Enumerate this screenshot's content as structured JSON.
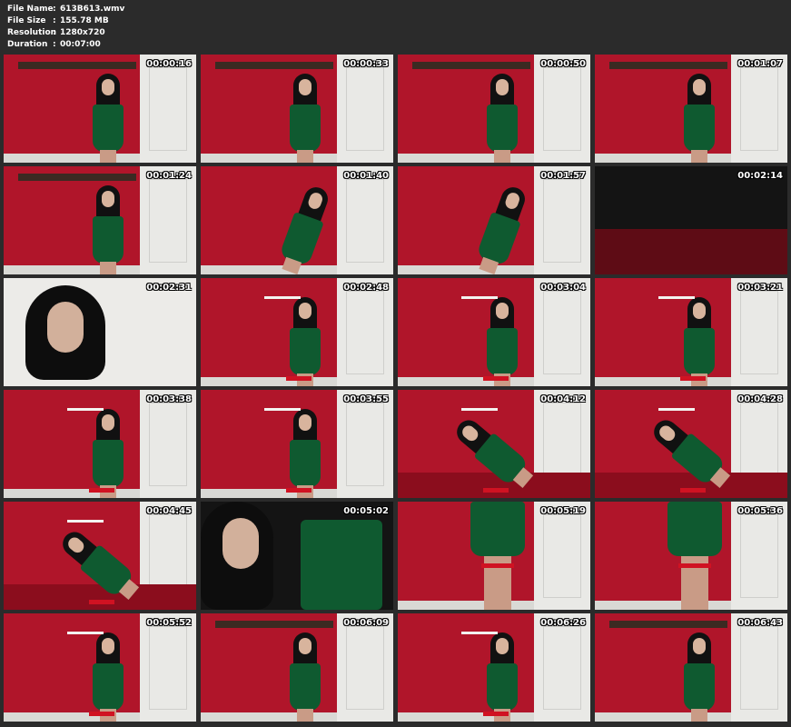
{
  "file_info": {
    "file_name_label": "File Name",
    "file_name_value": "613B613.wmv",
    "file_size_label": "File Size",
    "file_size_value": "155.78 MB",
    "resolution_label": "Resolution",
    "resolution_value": "1280x720",
    "duration_label": "Duration",
    "duration_value": "00:07:00"
  },
  "thumbnails": [
    {
      "timestamp": "00:00:16"
    },
    {
      "timestamp": "00:00:33"
    },
    {
      "timestamp": "00:00:50"
    },
    {
      "timestamp": "00:01:07"
    },
    {
      "timestamp": "00:01:24"
    },
    {
      "timestamp": "00:01:40"
    },
    {
      "timestamp": "00:01:57"
    },
    {
      "timestamp": "00:02:14"
    },
    {
      "timestamp": "00:02:31"
    },
    {
      "timestamp": "00:02:48"
    },
    {
      "timestamp": "00:03:04"
    },
    {
      "timestamp": "00:03:21"
    },
    {
      "timestamp": "00:03:38"
    },
    {
      "timestamp": "00:03:55"
    },
    {
      "timestamp": "00:04:12"
    },
    {
      "timestamp": "00:04:28"
    },
    {
      "timestamp": "00:04:45"
    },
    {
      "timestamp": "00:05:02"
    },
    {
      "timestamp": "00:05:19"
    },
    {
      "timestamp": "00:05:36"
    },
    {
      "timestamp": "00:05:52"
    },
    {
      "timestamp": "00:06:09"
    },
    {
      "timestamp": "00:06:26"
    },
    {
      "timestamp": "00:06:43"
    }
  ]
}
